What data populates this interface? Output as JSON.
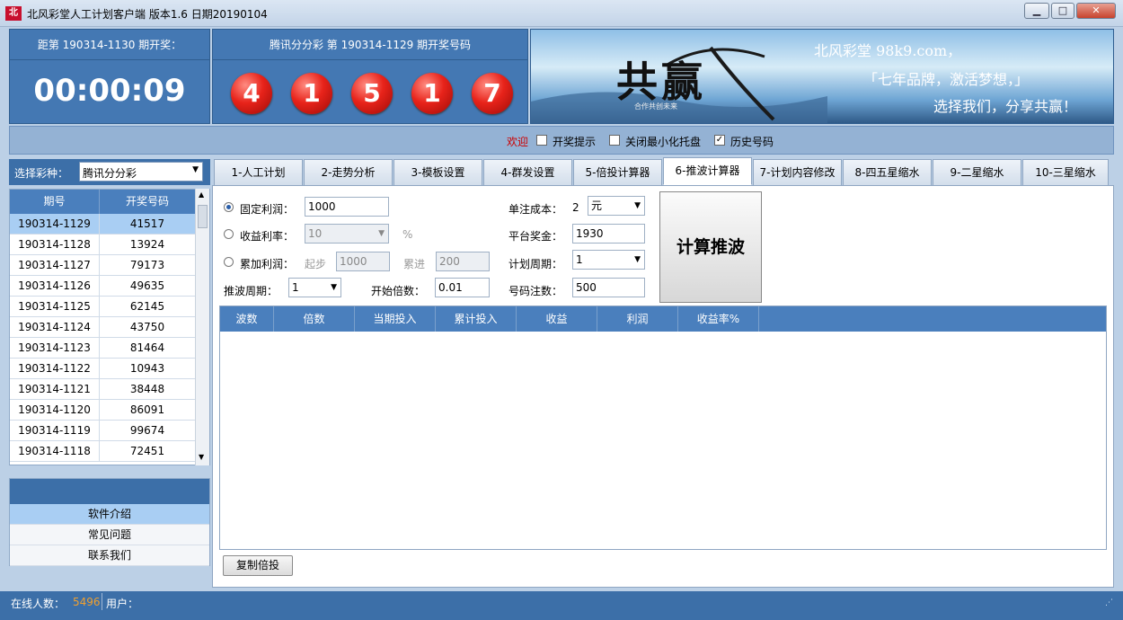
{
  "window": {
    "title": "北风彩堂人工计划客户端    版本1.6  日期20190104",
    "icon_text": "北",
    "minimize_icon": "minimize-icon",
    "maximize_icon": "maximize-icon",
    "close_icon": "close-icon"
  },
  "countdown": {
    "label": "距第 190314-1130 期开奖：",
    "time": "00:00:09"
  },
  "draw": {
    "label": "腾讯分分彩 第 190314-1129 期开奖号码",
    "balls": [
      "4",
      "1",
      "5",
      "1",
      "7"
    ]
  },
  "banner": {
    "calligraphy": "共赢",
    "seal": "合作共创未来",
    "line1": "北风彩堂 98k9.com，",
    "line2": "「七年品牌，激活梦想，」",
    "line3": "选择我们，分享共赢！"
  },
  "info": {
    "welcome": "欢迎",
    "opt1": "开奖提示",
    "opt2": "关闭最小化托盘",
    "opt3": "历史号码",
    "opt1_checked": false,
    "opt2_checked": false,
    "opt3_checked": true
  },
  "left": {
    "select_label": "选择彩种：",
    "select_value": "腾讯分分彩",
    "col_period": "期号",
    "col_number": "开奖号码",
    "rows": [
      [
        "190314-1129",
        "41517"
      ],
      [
        "190314-1128",
        "13924"
      ],
      [
        "190314-1127",
        "79173"
      ],
      [
        "190314-1126",
        "49635"
      ],
      [
        "190314-1125",
        "62145"
      ],
      [
        "190314-1124",
        "43750"
      ],
      [
        "190314-1123",
        "81464"
      ],
      [
        "190314-1122",
        "10943"
      ],
      [
        "190314-1121",
        "38448"
      ],
      [
        "190314-1120",
        "86091"
      ],
      [
        "190314-1119",
        "99674"
      ],
      [
        "190314-1118",
        "72451"
      ]
    ],
    "menu": [
      "软件介绍",
      "常见问题",
      "联系我们"
    ]
  },
  "tabs": [
    "1-人工计划",
    "2-走势分析",
    "3-模板设置",
    "4-群发设置",
    "5-倍投计算器",
    "6-推波计算器",
    "7-计划内容修改",
    "8-四五星缩水",
    "9-二星缩水",
    "10-三星缩水"
  ],
  "active_tab": 5,
  "form": {
    "fixed_profit_label": "固定利润：",
    "fixed_profit_value": "1000",
    "yield_rate_label": "收益利率：",
    "yield_rate_value": "10",
    "percent": "%",
    "cumulative_label": "累加利润：",
    "start_label": "起步",
    "start_value": "1000",
    "increment_label": "累进",
    "increment_value": "200",
    "push_cycle_label": "推波周期：",
    "push_cycle_value": "1",
    "start_multiple_label": "开始倍数：",
    "start_multiple_value": "0.01",
    "unit_cost_label": "单注成本：",
    "unit_cost_value": "2",
    "unit_value": "元",
    "platform_prize_label": "平台奖金：",
    "platform_prize_value": "1930",
    "plan_cycle_label": "计划周期：",
    "plan_cycle_value": "1",
    "bet_count_label": "号码注数：",
    "bet_count_value": "500",
    "calc_button": "计算推波"
  },
  "results": {
    "columns": [
      "波数",
      "倍数",
      "当期投入",
      "累计投入",
      "收益",
      "利润",
      "收益率%"
    ],
    "copy_button": "复制倍投"
  },
  "status": {
    "online_label": "在线人数：",
    "online_value": "5496",
    "user_label": "用户："
  },
  "colors": {
    "primary_blue": "#4478b3",
    "ball_red": "#e8231a",
    "online_count": "#f0a030"
  }
}
